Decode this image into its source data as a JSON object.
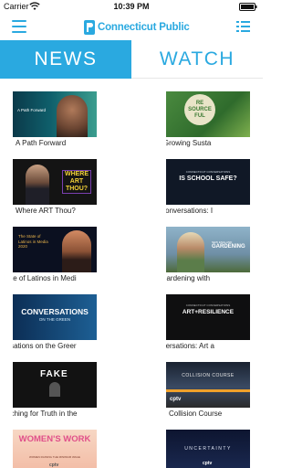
{
  "status": {
    "carrier": "Carrier",
    "time": "10:39 PM"
  },
  "header": {
    "brand": "Connecticut Public",
    "menu_icon": "hamburger-menu-icon",
    "list_icon": "list-view-icon",
    "accent": "#2aa9e0"
  },
  "tabs": [
    {
      "label": "NEWS",
      "active": true
    },
    {
      "label": "WATCH",
      "active": false
    }
  ],
  "cards": [
    {
      "caption": "A Path Forward",
      "overlay": "A Path Forward"
    },
    {
      "caption": "rce:ful - Growing Susta",
      "overlay": "RE SOURCE FUL"
    },
    {
      "caption": "Where ART Thou?",
      "overlay": "WHERE ART THOU?"
    },
    {
      "caption": "ecticut Conversations: I",
      "overlay": "IS SCHOOL SAFE?",
      "overlay_top": "CONNECTICUT CONVERSATIONS"
    },
    {
      "caption": "State of Latinos in Medi",
      "overlay": "The State of Latinos in Media 2020"
    },
    {
      "caption": "ngland Gardening with",
      "overlay": "GARDENING",
      "overlay_top": "NEW ENGLAND"
    },
    {
      "caption": "versations on the Greer",
      "overlay": "CONVERSATIONS",
      "overlay_sub": "ON THE GREEN"
    },
    {
      "caption": "cut Conversations: Art a",
      "overlay": "ART+RESILIENCE",
      "overlay_top": "CONNECTICUT CONVERSATIONS"
    },
    {
      "caption": "earching for Truth in the",
      "overlay": "FAKE"
    },
    {
      "caption": "Collision Course",
      "overlay": "COLLISION COURSE",
      "logo": "cptv"
    },
    {
      "caption": "",
      "overlay": "WOMEN'S WORK",
      "overlay_sub": "WOMEN RAISING THE MINIMUM WAGE",
      "logo": "cptv"
    },
    {
      "caption": "",
      "overlay": "UNCERTAINTY",
      "logo": "cptv"
    }
  ]
}
